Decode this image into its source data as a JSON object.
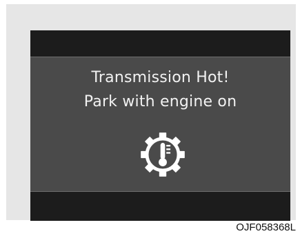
{
  "display": {
    "message_line1": "Transmission Hot!",
    "message_line2": "Park with engine on",
    "icon": "transmission-temperature-warning-icon"
  },
  "figure_code": "OJF058368L",
  "colors": {
    "panel_background": "#4a4a4a",
    "bar_background": "#1c1c1c",
    "text": "#f2f2f2",
    "frame": "#e6e6e6"
  }
}
